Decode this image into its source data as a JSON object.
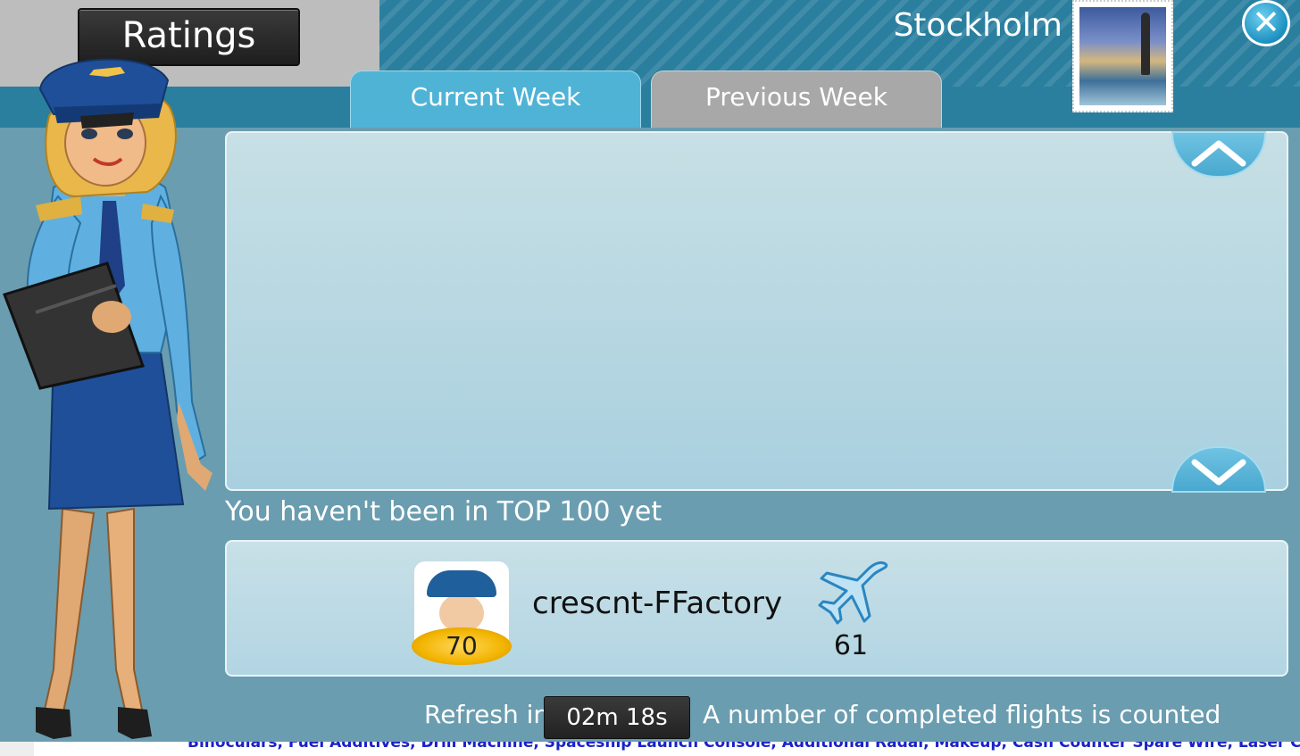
{
  "header": {
    "title": "Ratings",
    "city": "Stockholm",
    "close_icon": "close-icon"
  },
  "tabs": [
    {
      "label": "Current Week",
      "active": true
    },
    {
      "label": "Previous Week",
      "active": false
    }
  ],
  "status": {
    "message": "You haven't been in TOP 100 yet"
  },
  "player": {
    "name": "crescnt-FFactory",
    "level": "70",
    "flights": "61"
  },
  "footer": {
    "refresh_label": "Refresh in",
    "timer": "02m 18s",
    "info": "A number of completed flights is counted"
  },
  "bottom_strip": {
    "text": "Binoculars, Fuel Additives, Drill Machine, Spaceship Launch Console, Additional Radar, Makeup, Cash Counter Spare Wire, Laser Cutter,"
  },
  "colors": {
    "header_blue": "#2a7f9f",
    "active_tab": "#4fb3d6",
    "inactive_tab": "#a8a8a8"
  }
}
